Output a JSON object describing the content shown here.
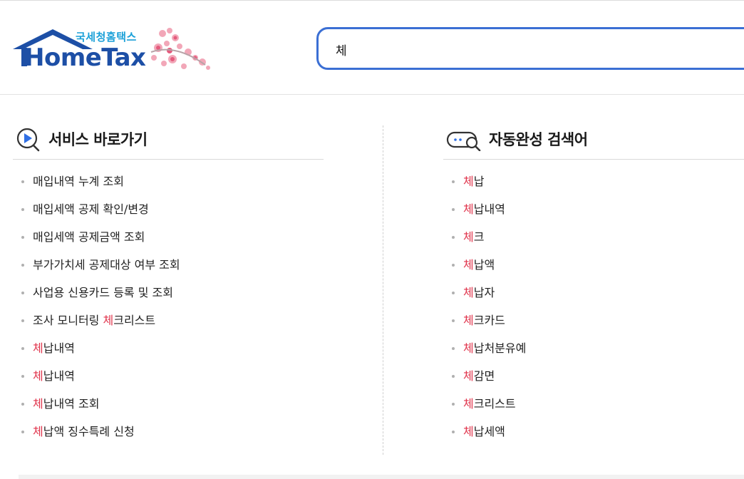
{
  "logo": {
    "subtitle": "국세청홈택스",
    "name": "HomeTax"
  },
  "search": {
    "value": "체",
    "placeholder": ""
  },
  "highlight_color": "#e0334b",
  "services": {
    "title": "서비스 바로가기",
    "items": [
      {
        "pre": "매입내역 누계 조회",
        "hl": "",
        "post": ""
      },
      {
        "pre": "매입세액 공제 확인/변경",
        "hl": "",
        "post": ""
      },
      {
        "pre": "매입세액 공제금액 조회",
        "hl": "",
        "post": ""
      },
      {
        "pre": "부가가치세 공제대상 여부 조회",
        "hl": "",
        "post": ""
      },
      {
        "pre": "사업용 신용카드 등록 및 조회",
        "hl": "",
        "post": ""
      },
      {
        "pre": "조사 모니터링 ",
        "hl": "체",
        "post": "크리스트"
      },
      {
        "pre": "",
        "hl": "체",
        "post": "납내역"
      },
      {
        "pre": "",
        "hl": "체",
        "post": "납내역"
      },
      {
        "pre": "",
        "hl": "체",
        "post": "납내역 조회"
      },
      {
        "pre": "",
        "hl": "체",
        "post": "납액 징수특례 신청"
      }
    ]
  },
  "autocomplete": {
    "title": "자동완성 검색어",
    "items": [
      {
        "pre": "",
        "hl": "체",
        "post": "납"
      },
      {
        "pre": "",
        "hl": "체",
        "post": "납내역"
      },
      {
        "pre": "",
        "hl": "체",
        "post": "크"
      },
      {
        "pre": "",
        "hl": "체",
        "post": "납액"
      },
      {
        "pre": "",
        "hl": "체",
        "post": "납자"
      },
      {
        "pre": "",
        "hl": "체",
        "post": "크카드"
      },
      {
        "pre": "",
        "hl": "체",
        "post": "납처분유예"
      },
      {
        "pre": "",
        "hl": "체",
        "post": "감면"
      },
      {
        "pre": "",
        "hl": "체",
        "post": "크리스트"
      },
      {
        "pre": "",
        "hl": "체",
        "post": "납세액"
      }
    ]
  }
}
